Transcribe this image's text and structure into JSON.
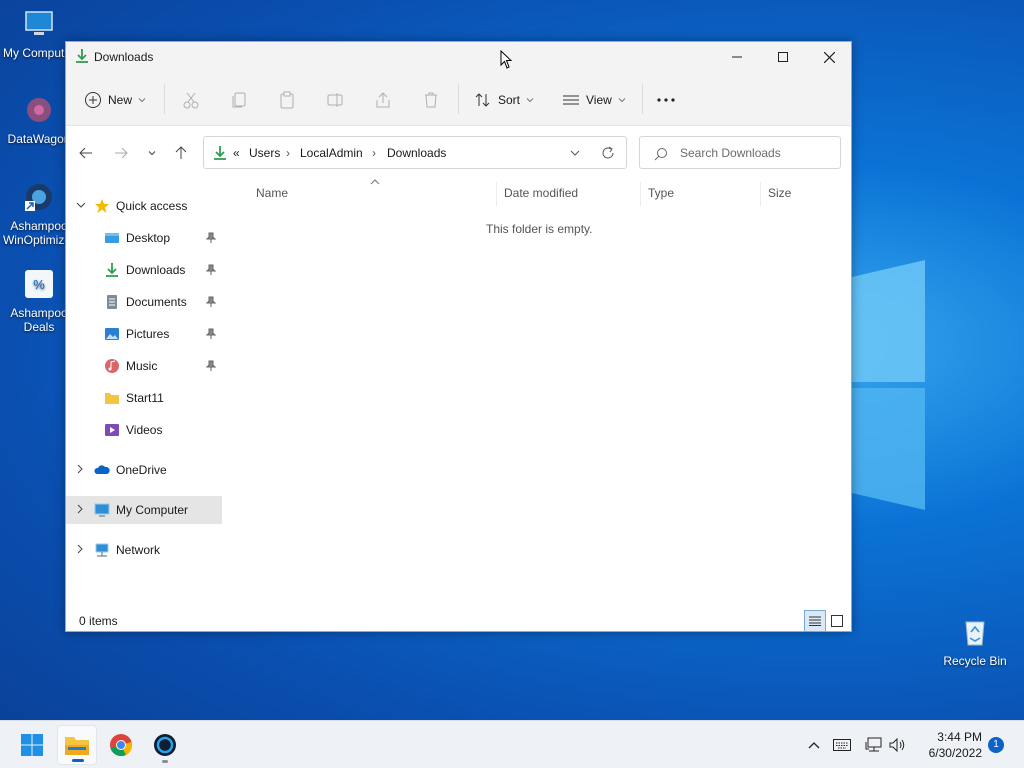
{
  "desktop": {
    "icons": [
      {
        "label": "My Computer",
        "icon": "monitor-icon"
      },
      {
        "label": "DataWagon",
        "icon": "datawagon-icon"
      },
      {
        "label": "Ashampoo WinOptimizer",
        "icon": "winoptimizer-icon"
      },
      {
        "label": "Ashampoo Deals",
        "icon": "deals-icon"
      },
      {
        "label": "Recycle Bin",
        "icon": "recycle-bin-icon"
      }
    ]
  },
  "window": {
    "title": "Downloads",
    "toolbar": {
      "new_label": "New",
      "sort_label": "Sort",
      "view_label": "View",
      "more_label": "···"
    },
    "address": {
      "overflow": "«",
      "crumbs": [
        "Users",
        "LocalAdmin",
        "Downloads"
      ],
      "sep": "›"
    },
    "search": {
      "placeholder": "Search Downloads"
    },
    "sidebar": {
      "quick_access": "Quick access",
      "items": [
        {
          "label": "Desktop",
          "icon": "desktop-icon",
          "pinned": true
        },
        {
          "label": "Downloads",
          "icon": "downloads-icon",
          "pinned": true
        },
        {
          "label": "Documents",
          "icon": "documents-icon",
          "pinned": true
        },
        {
          "label": "Pictures",
          "icon": "pictures-icon",
          "pinned": true
        },
        {
          "label": "Music",
          "icon": "music-icon",
          "pinned": true
        },
        {
          "label": "Start11",
          "icon": "folder-icon",
          "pinned": false
        },
        {
          "label": "Videos",
          "icon": "videos-icon",
          "pinned": false
        }
      ],
      "onedrive": "OneDrive",
      "my_computer": "My Computer",
      "network": "Network"
    },
    "columns": [
      "Name",
      "Date modified",
      "Type",
      "Size"
    ],
    "empty_message": "This folder is empty.",
    "status": "0 items"
  },
  "taskbar": {
    "time": "3:44 PM",
    "date": "6/30/2022",
    "notifications": "1"
  },
  "colors": {
    "accent": "#0a63c9",
    "download_green": "#2e9e4f",
    "folder_yellow": "#f6c443"
  }
}
